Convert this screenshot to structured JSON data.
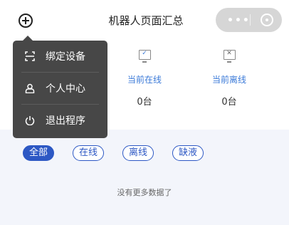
{
  "header": {
    "title": "机器人页面汇总",
    "capsule_dots": "•••"
  },
  "stats": [
    {
      "label": "",
      "value": "",
      "icon": "monitor-icon"
    },
    {
      "label": "当前在线",
      "value": "0台",
      "icon": "monitor-check-icon"
    },
    {
      "label": "当前离线",
      "value": "0台",
      "icon": "monitor-x-icon"
    }
  ],
  "tabs": [
    {
      "label": "全部",
      "active": true
    },
    {
      "label": "在线",
      "active": false
    },
    {
      "label": "离线",
      "active": false
    },
    {
      "label": "缺液",
      "active": false
    }
  ],
  "empty_text": "没有更多数据了",
  "menu": {
    "items": [
      {
        "label": "绑定设备",
        "icon": "scan-icon"
      },
      {
        "label": "个人中心",
        "icon": "user-icon"
      },
      {
        "label": "退出程序",
        "icon": "power-icon"
      }
    ]
  },
  "colors": {
    "accent": "#2d58c4",
    "menu_bg": "#474747",
    "content_bg": "#f3f5fb"
  }
}
